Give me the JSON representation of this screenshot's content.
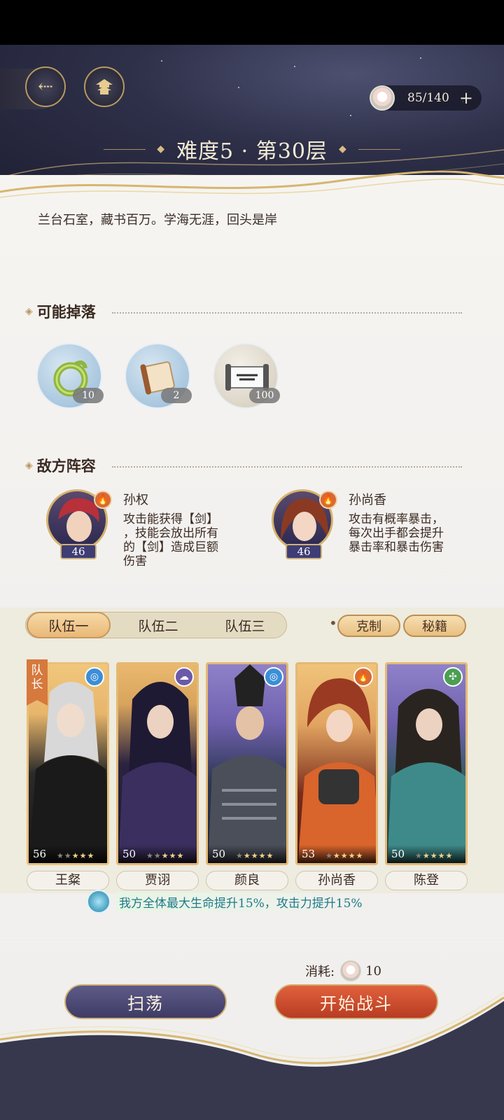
{
  "header": {
    "stamina": "85/140",
    "stamina_plus": "+",
    "title": "难度5 · 第30层"
  },
  "stage": {
    "description": "兰台石室，藏书百万。学海无涯，回头是岸"
  },
  "drops": {
    "heading": "可能掉落",
    "items": [
      {
        "icon": "jade-dragon-ring-icon",
        "count": "10"
      },
      {
        "icon": "scroll-icon",
        "count": "2"
      },
      {
        "icon": "embroidery-scroll-icon",
        "count": "100"
      }
    ]
  },
  "enemies": {
    "heading": "敌方阵容",
    "list": [
      {
        "name": "孙权",
        "level": "46",
        "element": "fire",
        "desc_lines": [
          "攻击能获得【剑】",
          "，技能会放出所有",
          "的【剑】造成巨额",
          "伤害"
        ]
      },
      {
        "name": "孙尚香",
        "level": "46",
        "element": "fire",
        "desc_lines": [
          "攻击有概率暴击，",
          "每次出手都会提升",
          "暴击率和暴击伤害"
        ]
      }
    ]
  },
  "team": {
    "tabs": [
      "队伍一",
      "队伍二",
      "队伍三"
    ],
    "active_tab": 0,
    "counter_button": "克制",
    "secret_button": "秘籍",
    "captain_label": "队长",
    "heroes": [
      {
        "name": "王粲",
        "level": "56",
        "element": "water",
        "stars": 5,
        "lit": 3
      },
      {
        "name": "贾诩",
        "level": "50",
        "element": "cloud",
        "stars": 5,
        "lit": 3
      },
      {
        "name": "颜良",
        "level": "50",
        "element": "water",
        "stars": 5,
        "lit": 4
      },
      {
        "name": "孙尚香",
        "level": "53",
        "element": "fire",
        "stars": 5,
        "lit": 4
      },
      {
        "name": "陈登",
        "level": "50",
        "element": "wind",
        "stars": 5,
        "lit": 4
      }
    ],
    "buff": "我方全体最大生命提升15%，攻击力提升15%"
  },
  "footer": {
    "cost_label": "消耗:",
    "cost_value": "10",
    "sweep_button": "扫荡",
    "battle_button": "开始战斗"
  },
  "colors": {
    "accent_gold": "#d2b274",
    "battle_red": "#c44a2b",
    "sweep_purple": "#4a4874",
    "fire": "#d76a34",
    "water": "#3c8ed6",
    "wind": "#4b9e52",
    "cloud": "#6a5aa8"
  }
}
